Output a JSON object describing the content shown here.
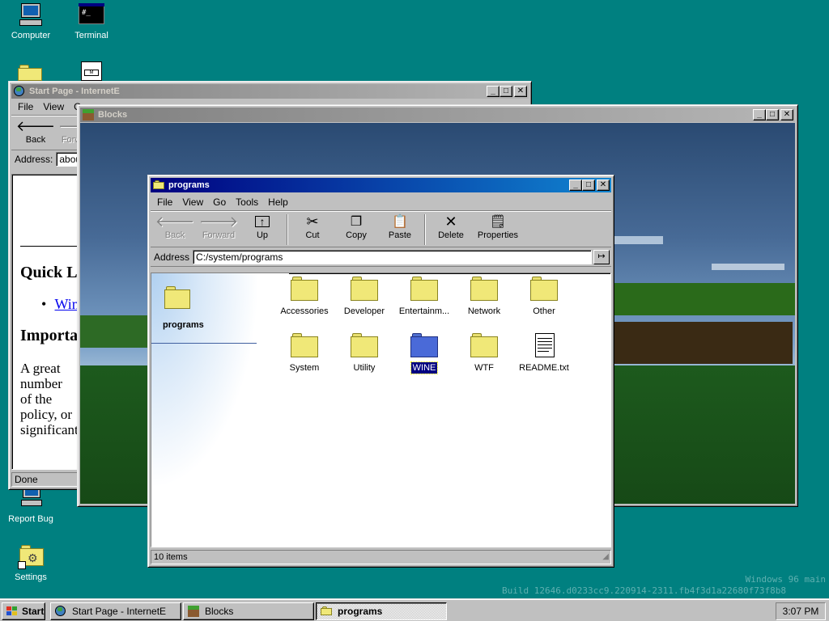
{
  "desktop": {
    "icons": [
      {
        "label": "Computer",
        "icon": "computer-icon"
      },
      {
        "label": "Terminal",
        "icon": "terminal-icon"
      },
      {
        "label": "Report Bug",
        "icon": "report-bug-icon"
      },
      {
        "label": "Settings",
        "icon": "settings-icon"
      }
    ],
    "watermark_line1": "Windows 96 main",
    "watermark_line2": "Build 12646.d0233cc9.220914-2311.fb4f3d1a22680f73f8b8"
  },
  "ie_window": {
    "title": "Start Page - InternetE",
    "menu": [
      "File",
      "View",
      "Go"
    ],
    "back_label": "Back",
    "forward_label": "Forward",
    "address_label": "Address:",
    "address_value": "about",
    "heading1": "Quick Links",
    "link1": "Windows",
    "heading2": "Important",
    "para": "A great number of the policy, or significant",
    "status": "Done"
  },
  "blocks_window": {
    "title": "Blocks"
  },
  "explorer": {
    "title": "programs",
    "menu": [
      "File",
      "View",
      "Go",
      "Tools",
      "Help"
    ],
    "toolbar": {
      "back": "Back",
      "forward": "Forward",
      "up": "Up",
      "cut": "Cut",
      "copy": "Copy",
      "paste": "Paste",
      "delete": "Delete",
      "properties": "Properties"
    },
    "address_label": "Address",
    "address_value": "C:/system/programs",
    "sidebar_title": "programs",
    "items": [
      {
        "name": "Accessories",
        "type": "folder"
      },
      {
        "name": "Developer",
        "type": "folder"
      },
      {
        "name": "Entertainm...",
        "type": "folder"
      },
      {
        "name": "Network",
        "type": "folder"
      },
      {
        "name": "Other",
        "type": "folder"
      },
      {
        "name": "System",
        "type": "folder"
      },
      {
        "name": "Utility",
        "type": "folder"
      },
      {
        "name": "WINE",
        "type": "folder-blue",
        "selected": true
      },
      {
        "name": "WTF",
        "type": "folder"
      },
      {
        "name": "README.txt",
        "type": "text-file"
      }
    ],
    "status": "10 items"
  },
  "taskbar": {
    "start_label": "Start",
    "tasks": [
      {
        "label": "Start Page - InternetE"
      },
      {
        "label": "Blocks"
      },
      {
        "label": "programs"
      }
    ],
    "clock": "3:07 PM"
  }
}
